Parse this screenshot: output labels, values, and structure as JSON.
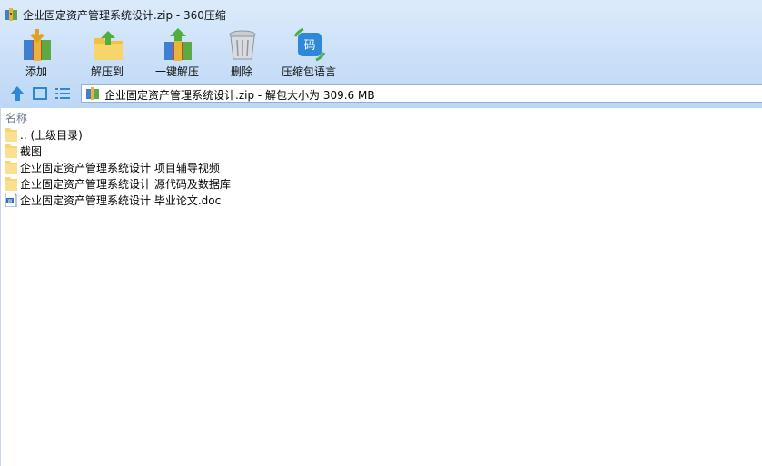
{
  "window": {
    "title": "企业固定资产管理系统设计.zip - 360压缩"
  },
  "toolbar": {
    "buttons": [
      {
        "label": "添加",
        "icon": "add-archive-icon"
      },
      {
        "label": "解压到",
        "icon": "extract-to-icon"
      },
      {
        "label": "一键解压",
        "icon": "one-click-extract-icon"
      },
      {
        "label": "删除",
        "icon": "trash-icon"
      },
      {
        "label": "压缩包语言",
        "icon": "archive-language-icon"
      }
    ]
  },
  "navbar": {
    "icons": [
      "up-arrow-icon",
      "view-large-icon",
      "view-list-icon"
    ],
    "address": "企业固定资产管理系统设计.zip - 解包大小为 309.6 MB"
  },
  "list": {
    "column_header": "名称",
    "items": [
      {
        "name": ".. (上级目录)",
        "type": "folder"
      },
      {
        "name": "截图",
        "type": "folder"
      },
      {
        "name": "企业固定资产管理系统设计 项目辅导视频",
        "type": "folder"
      },
      {
        "name": "企业固定资产管理系统设计 源代码及数据库",
        "type": "folder"
      },
      {
        "name": "企业固定资产管理系统设计 毕业论文.doc",
        "type": "doc"
      }
    ]
  },
  "colors": {
    "toolbar_top": "#dcebfb",
    "toolbar_bottom": "#bcd7f5",
    "folder": "#f7d774",
    "header_text": "#6b7b8c"
  }
}
